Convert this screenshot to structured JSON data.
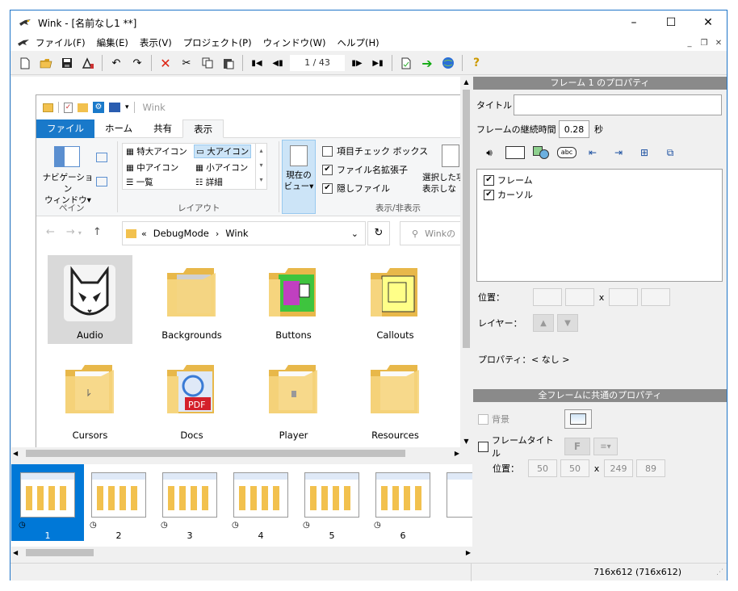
{
  "window": {
    "title": "Wink - [名前なし1 **]"
  },
  "window_controls": {
    "minimize": "–",
    "maximize": "☐",
    "close": "✕"
  },
  "menu": [
    "ファイル(F)",
    "編集(E)",
    "表示(V)",
    "プロジェクト(P)",
    "ウィンドウ(W)",
    "ヘルプ(H)"
  ],
  "mdi_controls": {
    "minimize": "_",
    "restore": "❐",
    "close": "✕"
  },
  "toolbar": {
    "page_indicator": "1 / 43"
  },
  "explorer": {
    "title": "Wink",
    "tabs": [
      "ファイル",
      "ホーム",
      "共有",
      "表示"
    ],
    "ribbon": {
      "nav_pane": "ナビゲーション\nウィンドウ▾",
      "group_pane": "ペイン",
      "layout_items": [
        "特大アイコン",
        "大アイコン",
        "中アイコン",
        "小アイコン",
        "一覧",
        "詳細"
      ],
      "group_layout": "レイアウト",
      "current_view": "現在の\nビュー▾",
      "show_hide": [
        "項目チェック ボックス",
        "ファイル名拡張子",
        "隠しファイル"
      ],
      "selected_hide": "選択した項\n表示しな",
      "group_show_hide": "表示/非表示"
    },
    "address": {
      "prefix": "«",
      "path1": "DebugMode",
      "sep": "›",
      "path2": "Wink"
    },
    "search_placeholder": "Winkの",
    "folders": [
      "Audio",
      "Backgrounds",
      "Buttons",
      "Callouts",
      "Cursors",
      "Docs",
      "Player",
      "Resources"
    ]
  },
  "thumbnails": [
    "1",
    "2",
    "3",
    "4",
    "5",
    "6"
  ],
  "frame_props": {
    "header": "フレーム 1 のプロパティ",
    "title_label": "タイトル",
    "title_value": "",
    "duration_label": "フレームの継続時間",
    "duration_value": "0.28",
    "duration_unit": "秒",
    "layers": [
      {
        "label": "フレーム",
        "checked": true
      },
      {
        "label": "カーソル",
        "checked": true
      }
    ],
    "position_label": "位置：",
    "x_sep": "x",
    "layer_label": "レイヤー：",
    "property_label": "プロパティ：",
    "property_value": "< なし >"
  },
  "common_props": {
    "header": "全フレームに共通のプロパティ",
    "background_label": "背景",
    "frame_title_label": "フレームタイトル",
    "position_label": "位置：",
    "pos_x": "50",
    "pos_y": "50",
    "x_sep": "x",
    "width": "249",
    "height": "89"
  },
  "status": {
    "size": "716x612 (716x612)"
  }
}
